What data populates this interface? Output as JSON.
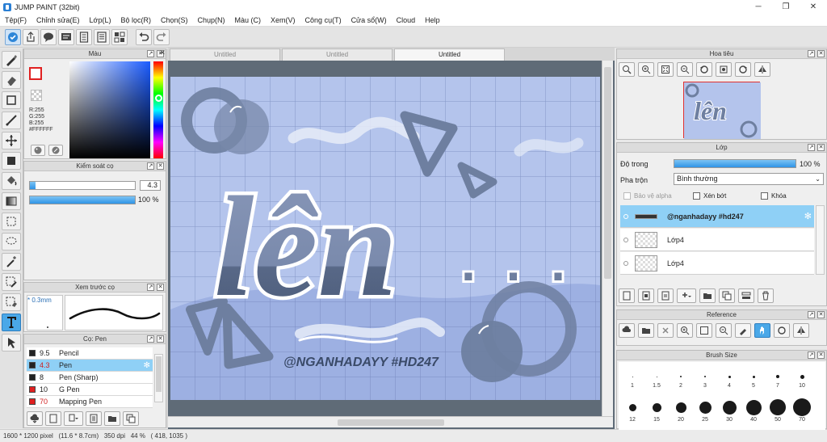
{
  "title": "JUMP PAINT (32bit)",
  "window_controls": [
    "─",
    "❐",
    "✕"
  ],
  "menu": [
    "Tệp(F)",
    "Chỉnh sửa(E)",
    "Lớp(L)",
    "Bộ lọc(R)",
    "Chọn(S)",
    "Chụp(N)",
    "Màu (C)",
    "Xem(V)",
    "Công cụ(T)",
    "Cửa sổ(W)",
    "Cloud",
    "Help"
  ],
  "color_panel": {
    "title": "Màu",
    "r": "R:255",
    "g": "G:255",
    "b": "B:255",
    "hex": "#FFFFFF",
    "accent": "#1a5bff"
  },
  "brush_control": {
    "title": "Kiểm soát cọ",
    "size_value": "4.3",
    "opacity_value": "100 %",
    "size_fraction": 0.05,
    "opacity_fraction": 1.0
  },
  "brush_preview": {
    "title": "Xem trước cọ",
    "size_label": "* 0.3mm"
  },
  "pen_panel": {
    "title": "Cọ: Pen",
    "items": [
      {
        "size": "9.5",
        "name": "Pencil",
        "color": "#222222"
      },
      {
        "size": "4.3",
        "name": "Pen",
        "color": "#222222"
      },
      {
        "size": "8",
        "name": "Pen (Sharp)",
        "color": "#222222"
      },
      {
        "size": "10",
        "name": "G Pen",
        "color": "#222222"
      },
      {
        "size": "70",
        "name": "Mapping Pen",
        "color": "#e02020"
      }
    ]
  },
  "document": {
    "tabs": [
      "Untitled",
      "Untitled",
      "Untitled"
    ],
    "canvas_main_text": "lên",
    "canvas_dots": ". . .",
    "canvas_handle": "@NGANHADAYY #HD247",
    "canvas_bg": "#b4c4ec",
    "ink_color": "#6e7fa0"
  },
  "status": {
    "text": "1600 * 1200 pixel   (11.6 * 8.7cm)   350 dpi   44 %   ( 418, 1035 )"
  },
  "navigator": {
    "title": "Hoa tiêu"
  },
  "layers": {
    "title": "Lớp",
    "opacity_label": "Độ trong",
    "opacity_value": "100 %",
    "opacity_fraction": 1.0,
    "blend_label": "Pha trộn",
    "blend_value": "Bình thường",
    "protect_alpha": "Bảo vệ alpha",
    "clipping": "Xén bớt",
    "lock": "Khóa",
    "rows": [
      "@nganhadayy #hd247",
      "Lớp4",
      "Lớp4"
    ]
  },
  "reference": {
    "title": "Reference"
  },
  "brush_size": {
    "title": "Brush Size",
    "row1_labels": [
      "1",
      "1.5",
      "2",
      "3",
      "4",
      "5",
      "7",
      "10"
    ],
    "row2_labels": [
      "12",
      "15",
      "20",
      "25",
      "30",
      "40",
      "50",
      "70"
    ]
  }
}
